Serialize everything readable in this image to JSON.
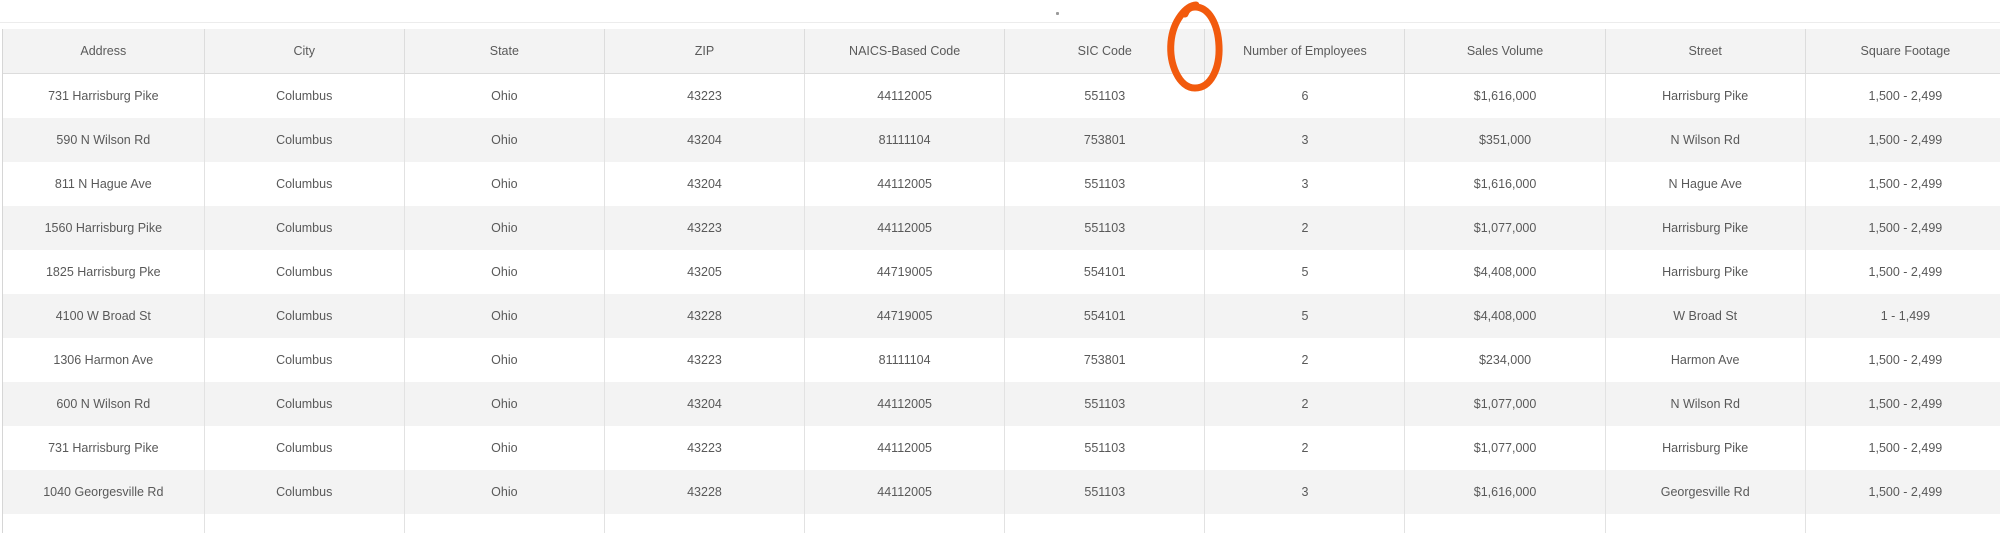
{
  "table": {
    "columns": [
      "Address",
      "City",
      "State",
      "ZIP",
      "NAICS-Based Code",
      "SIC Code",
      "Number of Employees",
      "Sales Volume",
      "Street",
      "Square Footage"
    ],
    "rows": [
      [
        "731 Harrisburg Pike",
        "Columbus",
        "Ohio",
        "43223",
        "44112005",
        "551103",
        "6",
        "$1,616,000",
        "Harrisburg Pike",
        "1,500 - 2,499"
      ],
      [
        "590 N Wilson Rd",
        "Columbus",
        "Ohio",
        "43204",
        "81111104",
        "753801",
        "3",
        "$351,000",
        "N Wilson Rd",
        "1,500 - 2,499"
      ],
      [
        "811 N Hague Ave",
        "Columbus",
        "Ohio",
        "43204",
        "44112005",
        "551103",
        "3",
        "$1,616,000",
        "N Hague Ave",
        "1,500 - 2,499"
      ],
      [
        "1560 Harrisburg Pike",
        "Columbus",
        "Ohio",
        "43223",
        "44112005",
        "551103",
        "2",
        "$1,077,000",
        "Harrisburg Pike",
        "1,500 - 2,499"
      ],
      [
        "1825 Harrisburg Pke",
        "Columbus",
        "Ohio",
        "43205",
        "44719005",
        "554101",
        "5",
        "$4,408,000",
        "Harrisburg Pike",
        "1,500 - 2,499"
      ],
      [
        "4100 W Broad St",
        "Columbus",
        "Ohio",
        "43228",
        "44719005",
        "554101",
        "5",
        "$4,408,000",
        "W Broad St",
        "1 - 1,499"
      ],
      [
        "1306 Harmon Ave",
        "Columbus",
        "Ohio",
        "43223",
        "81111104",
        "753801",
        "2",
        "$234,000",
        "Harmon Ave",
        "1,500 - 2,499"
      ],
      [
        "600 N Wilson Rd",
        "Columbus",
        "Ohio",
        "43204",
        "44112005",
        "551103",
        "2",
        "$1,077,000",
        "N Wilson Rd",
        "1,500 - 2,499"
      ],
      [
        "731 Harrisburg Pike",
        "Columbus",
        "Ohio",
        "43223",
        "44112005",
        "551103",
        "2",
        "$1,077,000",
        "Harrisburg Pike",
        "1,500 - 2,499"
      ],
      [
        "1040 Georgesville Rd",
        "Columbus",
        "Ohio",
        "43228",
        "44112005",
        "551103",
        "3",
        "$1,616,000",
        "Georgesville Rd",
        "1,500 - 2,499"
      ],
      [
        "",
        "",
        "",
        "",
        "",
        "",
        "",
        "",
        "",
        ""
      ]
    ]
  },
  "colors": {
    "annotation": "#f25a0d",
    "header_bg": "#f3f3f3",
    "row_alt_bg": "#f3f3f3"
  },
  "icons": {
    "annotation": "hand-drawn-circle"
  }
}
